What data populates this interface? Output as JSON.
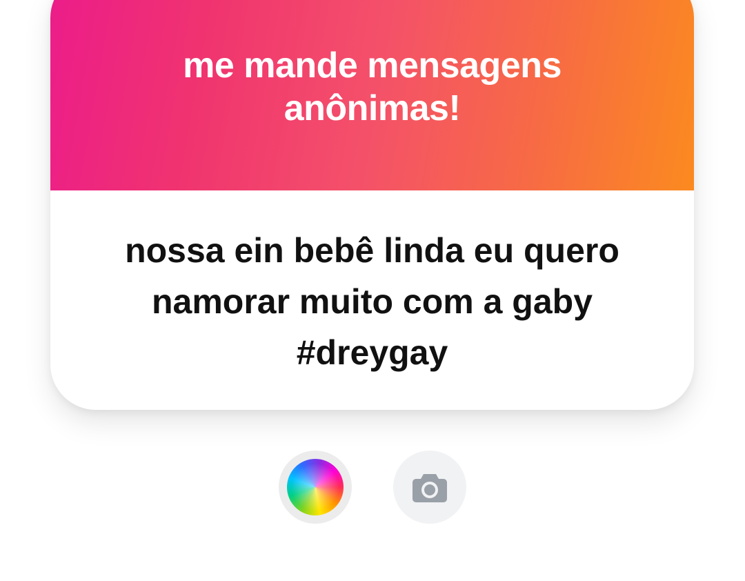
{
  "card": {
    "title": "me mande mensagens anônimas!",
    "message": "nossa ein bebê linda eu quero namorar muito com a gaby #dreygay",
    "gradient_colors": [
      "#ec1c8a",
      "#f4506a",
      "#fb8a1f"
    ]
  },
  "tools": {
    "color_picker_icon": "color-wheel-icon",
    "camera_icon": "camera-icon",
    "camera_icon_color": "#9aa0a8"
  }
}
